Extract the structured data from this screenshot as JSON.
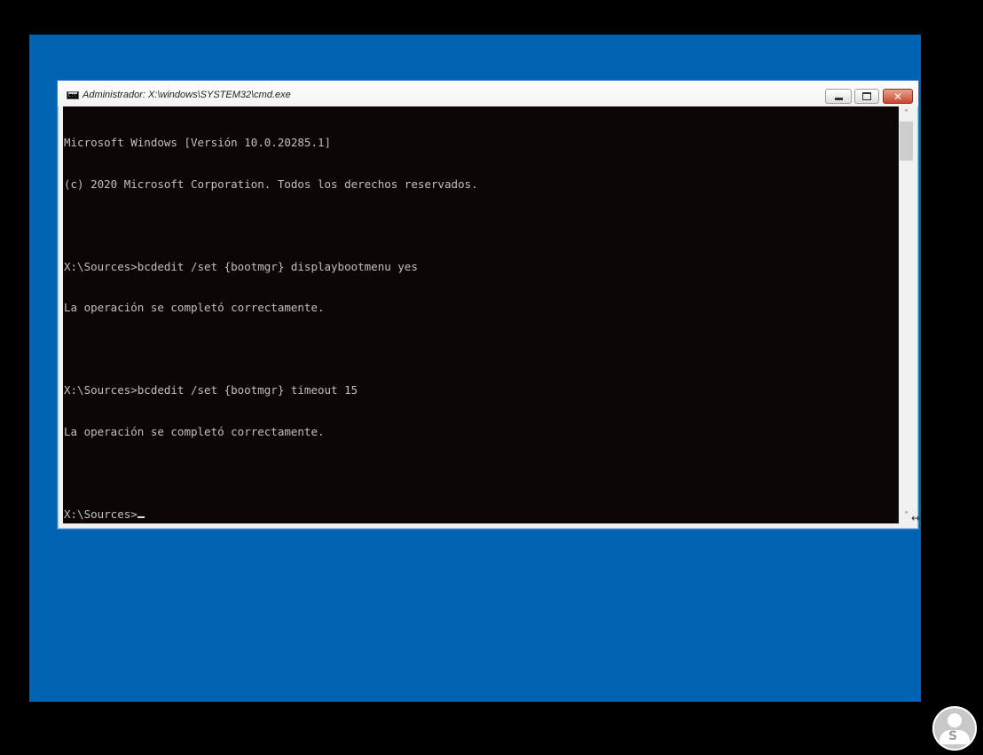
{
  "window": {
    "title": "Administrador: X:\\windows\\SYSTEM32\\cmd.exe",
    "app_icon": "cmd-icon",
    "controls": {
      "minimize_icon": "minimize-icon",
      "maximize_icon": "maximize-icon",
      "close_icon": "close-icon"
    }
  },
  "console": {
    "lines": [
      "Microsoft Windows [Versión 10.0.20285.1]",
      "(c) 2020 Microsoft Corporation. Todos los derechos reservados.",
      "",
      "X:\\Sources>bcdedit /set {bootmgr} displaybootmenu yes",
      "La operación se completó correctamente.",
      "",
      "X:\\Sources>bcdedit /set {bootmgr} timeout 15",
      "La operación se completó correctamente.",
      "",
      "X:\\Sources>"
    ],
    "foreground_color": "#c0c0c0",
    "background_color": "#0c0605"
  },
  "scrollbar": {
    "up_glyph": "˄",
    "down_glyph": "˅",
    "resize_glyph": "↔"
  },
  "colors": {
    "desktop": "#0063b1",
    "frame": "#000000",
    "close_button": "#c9462c"
  },
  "watermark": {
    "icon": "user-logo-icon",
    "letter": "S"
  }
}
